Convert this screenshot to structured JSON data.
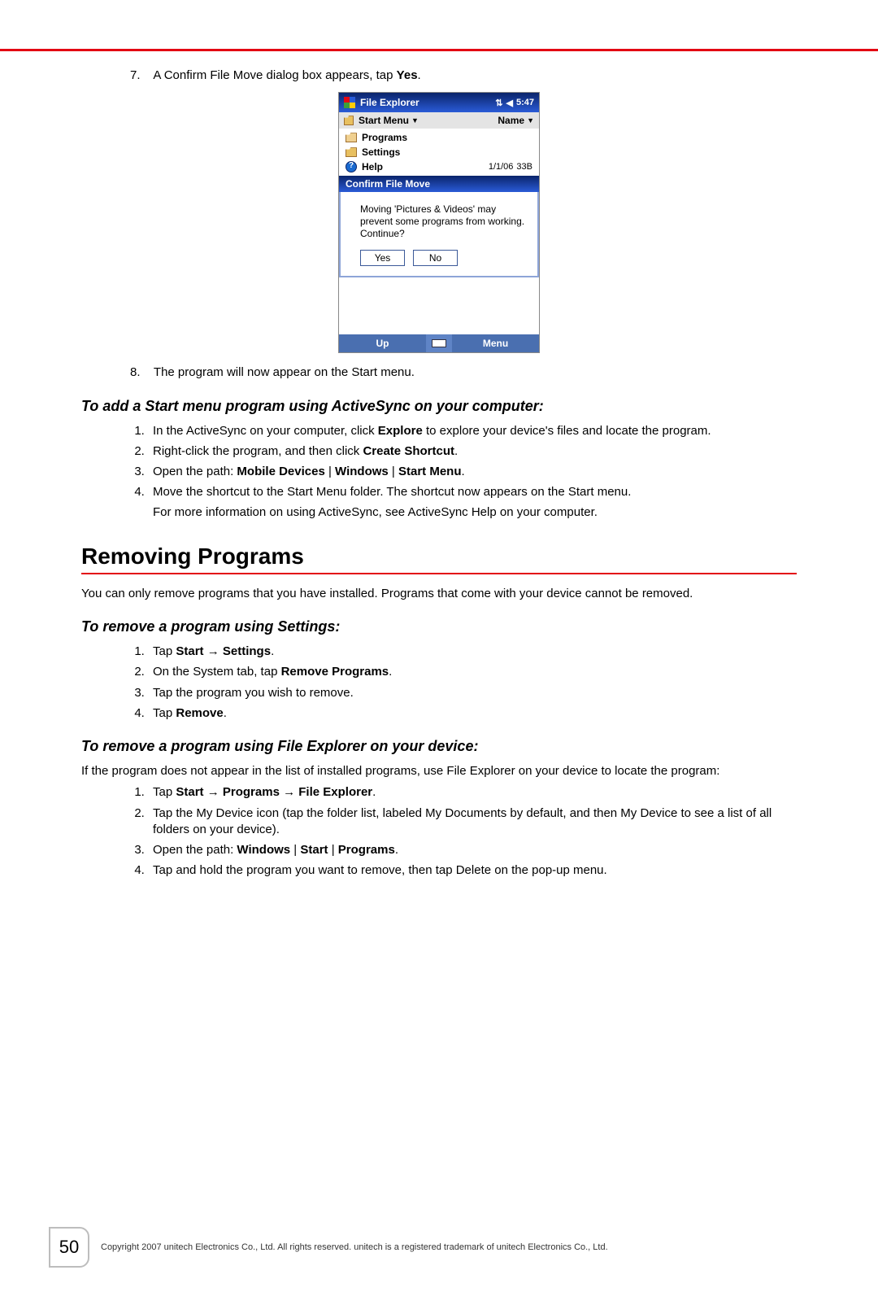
{
  "stepA": {
    "num": "7.",
    "text_before": "A Confirm File Move dialog box appears, tap ",
    "bold": "Yes",
    "text_after": "."
  },
  "screenshot": {
    "title": "File Explorer",
    "time": "5:47",
    "breadcrumb": "Start Menu",
    "sort": "Name",
    "rows": [
      {
        "name": "Programs",
        "type": "folder-open"
      },
      {
        "name": "Settings",
        "type": "folder"
      },
      {
        "name": "Help",
        "type": "help",
        "date": "1/1/06",
        "size": "33B"
      }
    ],
    "dialog": {
      "title": "Confirm File Move",
      "message": "Moving 'Pictures & Videos' may prevent some programs from working. Continue?",
      "yes": "Yes",
      "no": "No"
    },
    "bottom": {
      "left": "Up",
      "right": "Menu"
    }
  },
  "stepB": {
    "num": "8.",
    "text": "The program will now appear on the Start menu."
  },
  "sub1": "To add a Start menu program using ActiveSync on your computer:",
  "list1": {
    "i1_a": "In the ActiveSync on your computer, click ",
    "i1_b": "Explore",
    "i1_c": " to explore your device's files and locate the program.",
    "i2_a": "Right-click the program, and then click ",
    "i2_b": "Create Shortcut",
    "i2_c": ".",
    "i3_a": "Open the path: ",
    "i3_b": "Mobile Devices",
    "i3_sep1": " | ",
    "i3_c": "Windows",
    "i3_sep2": " | ",
    "i3_d": "Start Menu",
    "i3_e": ".",
    "i4_a": "Move the shortcut to the Start Menu folder. The shortcut now appears on the Start menu.",
    "i4_after": "For more information on using ActiveSync, see ActiveSync Help on your computer."
  },
  "head2": "Removing Programs",
  "para2": "You can only remove programs that you have installed. Programs that come with your device cannot be removed.",
  "sub2": "To remove a program using Settings:",
  "list2": {
    "i1_a": "Tap ",
    "i1_b": "Start",
    "i1_arrow": " → ",
    "i1_c": "Settings",
    "i1_d": ".",
    "i2_a": "On the System tab, tap ",
    "i2_b": "Remove Programs",
    "i2_c": ".",
    "i3": "Tap the program you wish to remove.",
    "i4_a": "Tap ",
    "i4_b": "Remove",
    "i4_c": "."
  },
  "sub3": "To remove a program using File Explorer on your device:",
  "para3": "If the program does not appear in the list of installed programs, use File Explorer on your device to locate the program:",
  "list3": {
    "i1_a": "Tap ",
    "i1_b": "Start",
    "i1_ar1": " → ",
    "i1_c": "Programs",
    "i1_ar2": " → ",
    "i1_d": "File Explorer",
    "i1_e": ".",
    "i2": "Tap the My Device icon (tap the folder list, labeled My Documents by default, and then My Device to see a list of all folders on your device).",
    "i3_a": "Open the path: ",
    "i3_b": "Windows",
    "i3_s1": " | ",
    "i3_c": "Start",
    "i3_s2": " | ",
    "i3_d": "Programs",
    "i3_e": ".",
    "i4": "Tap and hold the program you want to remove, then tap Delete on the pop-up menu."
  },
  "footer": {
    "pagenum": "50",
    "copyright": "Copyright 2007 unitech Electronics Co., Ltd. All rights reserved. unitech is a registered trademark of unitech Electronics Co., Ltd."
  }
}
